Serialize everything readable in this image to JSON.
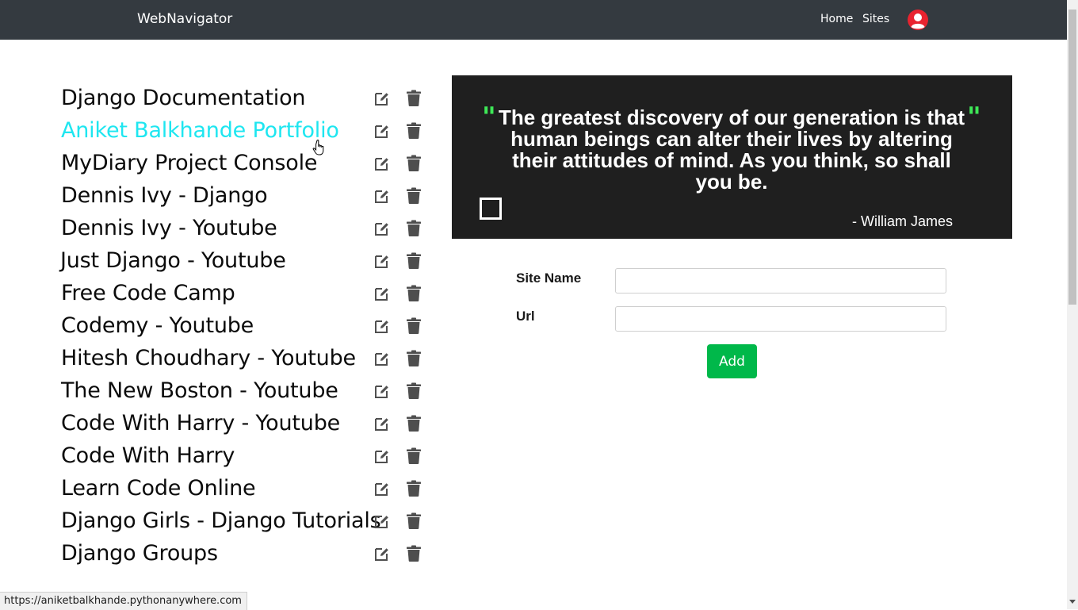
{
  "navbar": {
    "brand": "WebNavigator",
    "links": [
      "Home",
      "Sites"
    ]
  },
  "sites": [
    "Django Documentation",
    "Aniket Balkhande Portfolio",
    "MyDiary Project Console",
    "Dennis Ivy - Django",
    "Dennis Ivy - Youtube",
    "Just Django - Youtube",
    "Free Code Camp",
    "Codemy - Youtube",
    "Hitesh Choudhary - Youtube",
    "The New Boston - Youtube",
    "Code With Harry - Youtube",
    "Code With Harry",
    "Learn Code Online",
    "Django Girls - Django Tutorials",
    "Django Groups"
  ],
  "quote": {
    "text": "The greatest discovery of our generation is that human beings can alter their lives by altering their attitudes of mind. As you think, so shall you be.",
    "author": "-  William James",
    "open_mark": "\"",
    "close_mark": "\""
  },
  "form": {
    "site_name_label": "Site Name",
    "url_label": "Url",
    "site_name_value": "",
    "url_value": "",
    "add_label": "Add"
  },
  "status_bar": {
    "url": "https://aniketbalkhande.pythonanywhere.com"
  },
  "colors": {
    "navbar_bg": "#343a40",
    "link_hover": "#1ee6f0",
    "quote_bg": "#1f1f1f",
    "quote_mark": "#3ee857",
    "add_button": "#00b84a"
  }
}
